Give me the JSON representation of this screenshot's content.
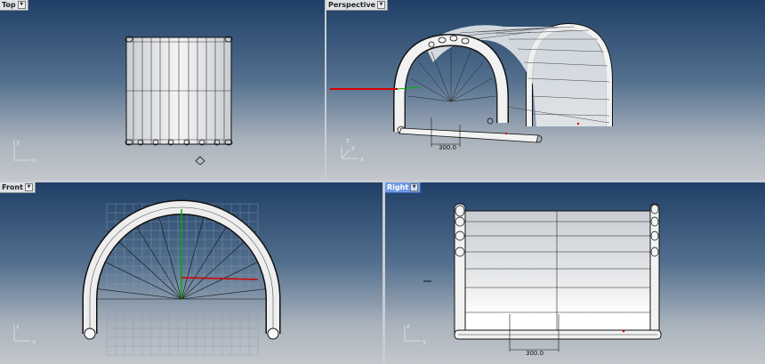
{
  "viewports": {
    "top": {
      "label": "Top"
    },
    "perspective": {
      "label": "Perspective"
    },
    "front": {
      "label": "Front"
    },
    "right": {
      "label": "Right"
    }
  },
  "axes": {
    "x": "x",
    "y": "y",
    "z": "z"
  },
  "dimensions": {
    "perspective": "300.0",
    "right": "300.0"
  },
  "colors": {
    "viewport_gradient_top": "#1f3f66",
    "viewport_gradient_bottom": "#c3c7cc",
    "active_tab": "#6f9be3",
    "x_axis": "#d40000",
    "y_axis": "#00b000"
  },
  "icons": {
    "dropdown": "chevron-down-icon"
  }
}
